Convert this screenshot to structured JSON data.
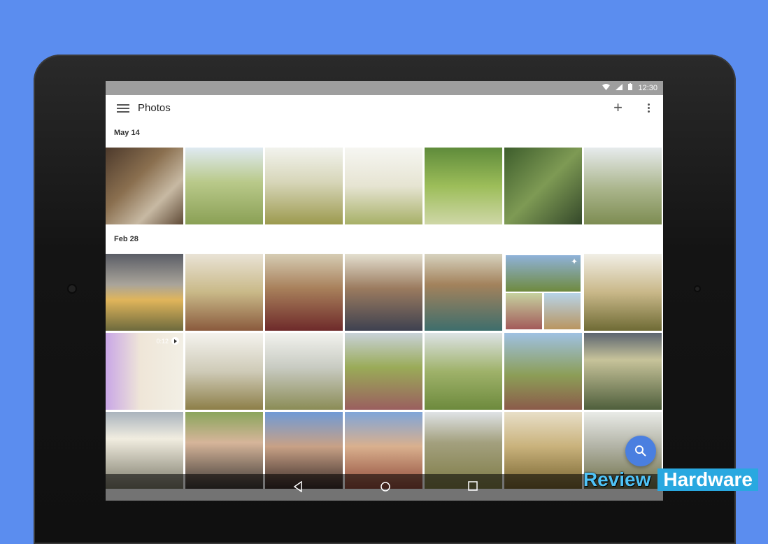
{
  "status_bar": {
    "time": "12:30"
  },
  "app_bar": {
    "title": "Photos",
    "menu_icon": "menu-icon",
    "add_icon": "plus-icon",
    "more_icon": "more-vert-icon"
  },
  "sections": [
    {
      "date": "May 14"
    },
    {
      "date": "Feb 28"
    }
  ],
  "video_badge": {
    "duration": "0:12"
  },
  "fab": {
    "icon": "search-icon",
    "color": "#4a7fe0"
  },
  "navigation": {
    "back_icon": "back-icon",
    "home_icon": "home-icon",
    "recents_icon": "recents-icon"
  },
  "watermark": {
    "part1": "Review",
    "part2": "Hardware"
  },
  "colors": {
    "background": "#5b8def",
    "accent": "#4a7fe0"
  }
}
